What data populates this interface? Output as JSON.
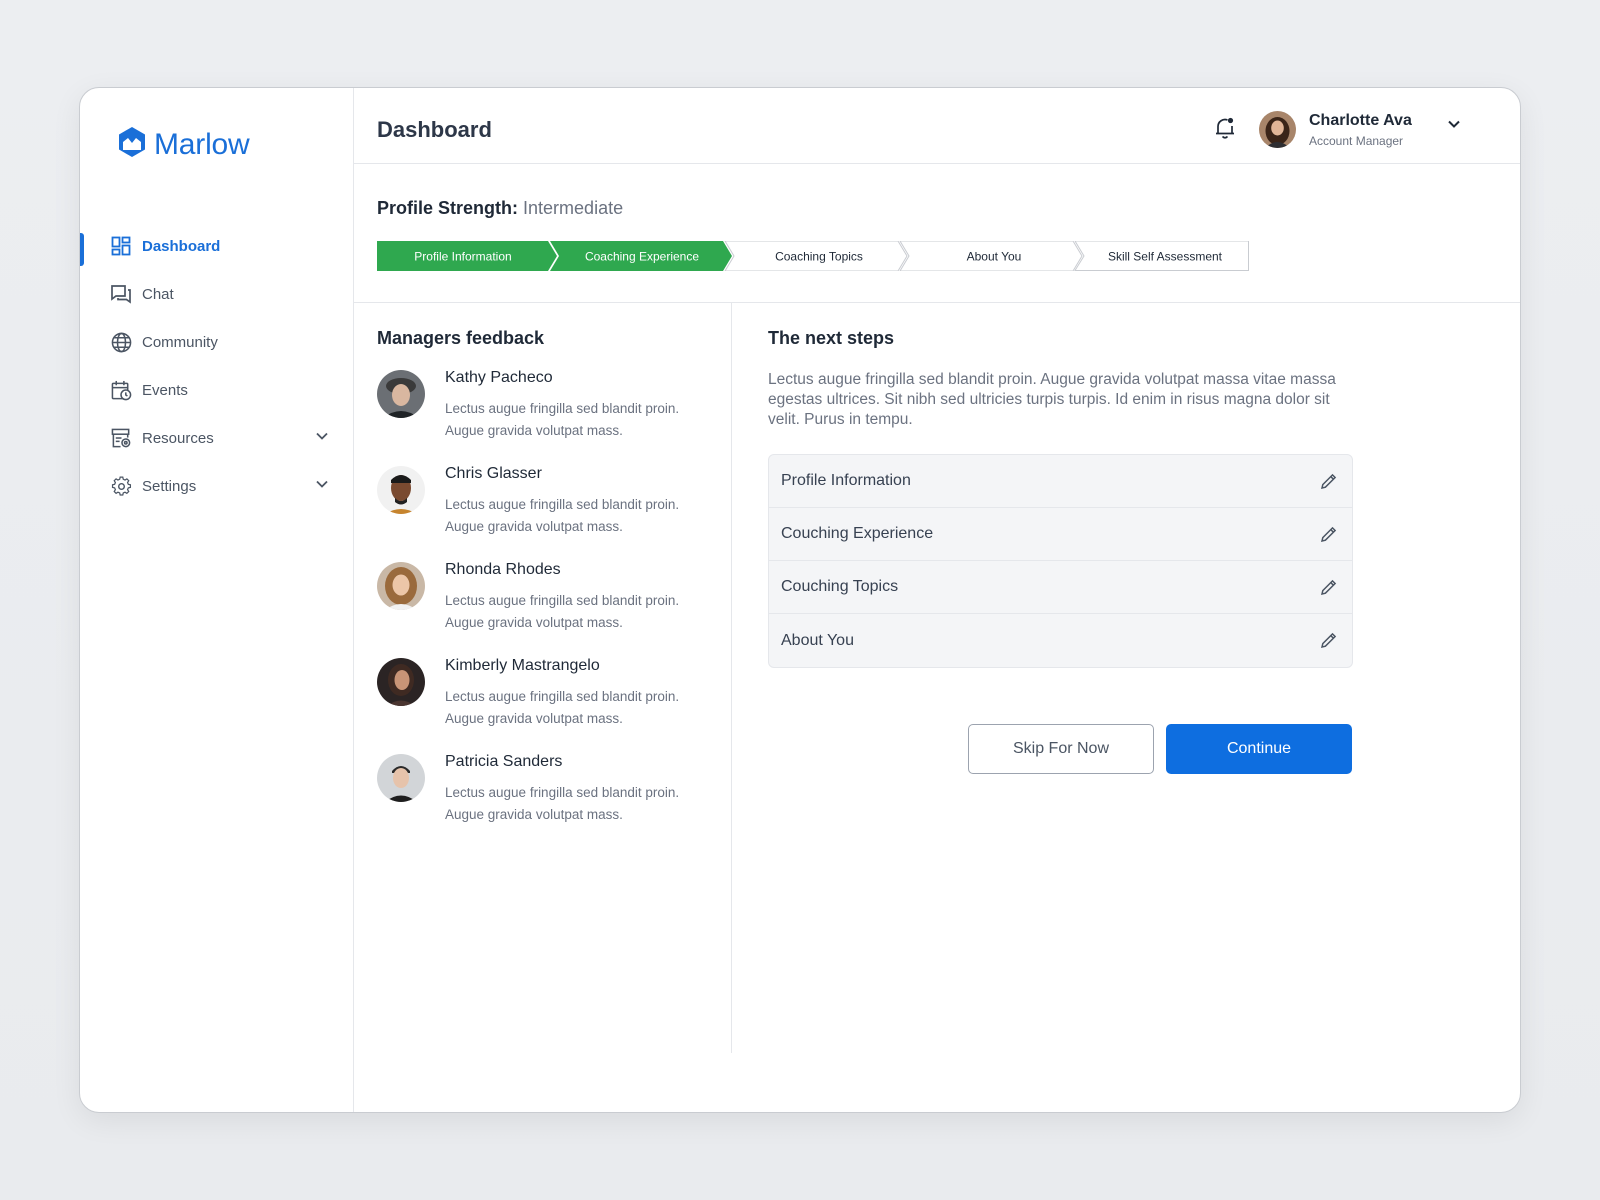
{
  "brand": {
    "name": "Marlow"
  },
  "sidebar": {
    "items": [
      {
        "label": "Dashboard",
        "icon": "dashboard-icon",
        "active": true,
        "expandable": false
      },
      {
        "label": "Chat",
        "icon": "chat-icon",
        "active": false,
        "expandable": false
      },
      {
        "label": "Community",
        "icon": "globe-icon",
        "active": false,
        "expandable": false
      },
      {
        "label": "Events",
        "icon": "calendar-icon",
        "active": false,
        "expandable": false
      },
      {
        "label": "Resources",
        "icon": "resources-icon",
        "active": false,
        "expandable": true
      },
      {
        "label": "Settings",
        "icon": "gear-icon",
        "active": false,
        "expandable": true
      }
    ]
  },
  "header": {
    "title": "Dashboard",
    "user": {
      "name": "Charlotte Ava",
      "role": "Account Manager"
    }
  },
  "profile_strength": {
    "label": "Profile Strength:",
    "value": "Intermediate",
    "steps": [
      {
        "label": "Profile Information",
        "done": true
      },
      {
        "label": "Coaching Experience",
        "done": true
      },
      {
        "label": "Coaching Topics",
        "done": false
      },
      {
        "label": "About You",
        "done": false
      },
      {
        "label": "Skill Self Assessment",
        "done": false
      }
    ]
  },
  "feedback": {
    "title": "Managers feedback",
    "items": [
      {
        "name": "Kathy Pacheco",
        "text": "Lectus augue fringilla sed blandit proin. Augue gravida volutpat mass."
      },
      {
        "name": "Chris Glasser",
        "text": "Lectus augue fringilla sed blandit proin. Augue gravida volutpat mass."
      },
      {
        "name": "Rhonda Rhodes",
        "text": "Lectus augue fringilla sed blandit proin. Augue gravida volutpat mass."
      },
      {
        "name": "Kimberly Mastrangelo",
        "text": "Lectus augue fringilla sed blandit proin. Augue gravida volutpat mass."
      },
      {
        "name": "Patricia Sanders",
        "text": "Lectus augue fringilla sed blandit proin. Augue gravida volutpat mass."
      }
    ]
  },
  "next_steps": {
    "title": "The next steps",
    "description": "Lectus augue fringilla sed blandit proin. Augue gravida volutpat massa vitae massa egestas ultrices. Sit nibh sed ultricies turpis turpis. Id enim in risus magna dolor sit velit. Purus in tempu.",
    "items": [
      {
        "label": "Profile Information"
      },
      {
        "label": "Couching Experience"
      },
      {
        "label": "Couching Topics"
      },
      {
        "label": "About You"
      }
    ],
    "skip_label": "Skip For Now",
    "continue_label": "Continue"
  },
  "colors": {
    "accent": "#1a6fd8",
    "success": "#2fa84f",
    "primary_button": "#0e6ee0"
  }
}
